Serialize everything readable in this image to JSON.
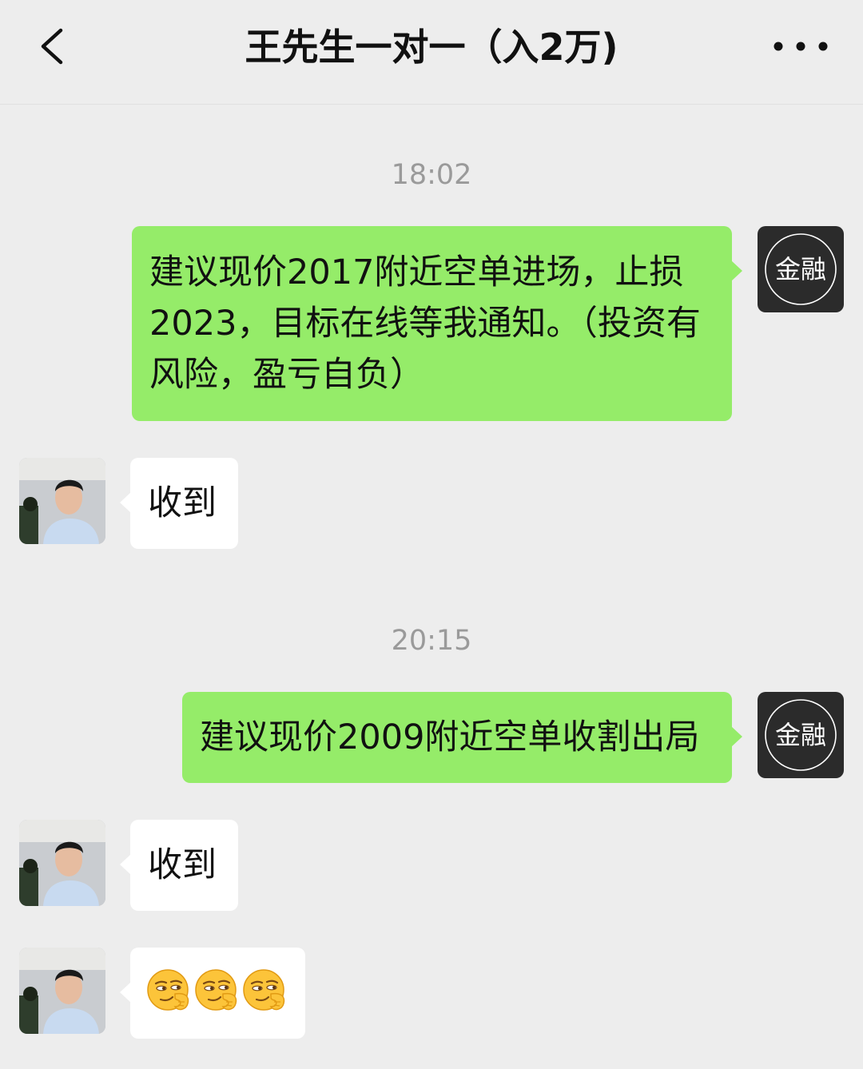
{
  "header": {
    "title": "王先生一对一（入2万)",
    "back_icon": "chevron-left-icon",
    "more_icon": "more-dots-icon"
  },
  "brand_avatar": {
    "text": "金融"
  },
  "messages": [
    {
      "type": "time",
      "text": "18:02"
    },
    {
      "type": "sent",
      "text": "建议现价2017附近空单进场，止损2023，目标在线等我通知。（投资有风险，盈亏自负）"
    },
    {
      "type": "received",
      "text": "收到"
    },
    {
      "type": "time",
      "text": "20:15"
    },
    {
      "type": "sent",
      "text": "建议现价2009附近空单收割出局"
    },
    {
      "type": "received",
      "text": "收到"
    },
    {
      "type": "received_emoji",
      "emoji": [
        "smirk-emoji",
        "smirk-emoji",
        "smirk-emoji"
      ]
    }
  ],
  "colors": {
    "background": "#ededed",
    "sent_bubble": "#95ec69",
    "received_bubble": "#ffffff",
    "timestamp": "#9a9a9a",
    "brand_avatar_bg": "#2b2b2b"
  }
}
